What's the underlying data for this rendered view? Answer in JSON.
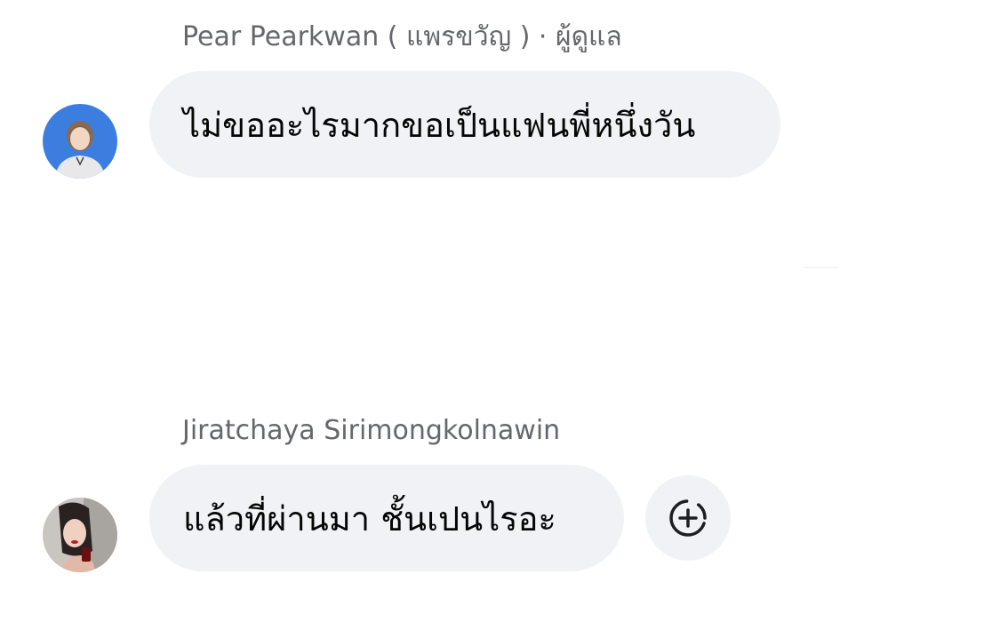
{
  "messages": [
    {
      "sender": "Pear Pearkwan ( แพรขวัญ ) · ผู้ดูแล",
      "text": "ไม่ขออะไรมากขอเป็นแฟนพี่หนึ่งวัน",
      "avatar_icon": "profile-photo"
    },
    {
      "sender": "Jiratchaya Sirimongkolnawin",
      "text": "แล้วที่ผ่านมา ชั้นเปนไรอะ",
      "avatar_icon": "profile-photo",
      "reaction_icon": "add-reaction-icon"
    }
  ],
  "colors": {
    "bubble_bg": "#f0f2f5",
    "sender_text": "#65676b",
    "message_text": "#050505"
  }
}
